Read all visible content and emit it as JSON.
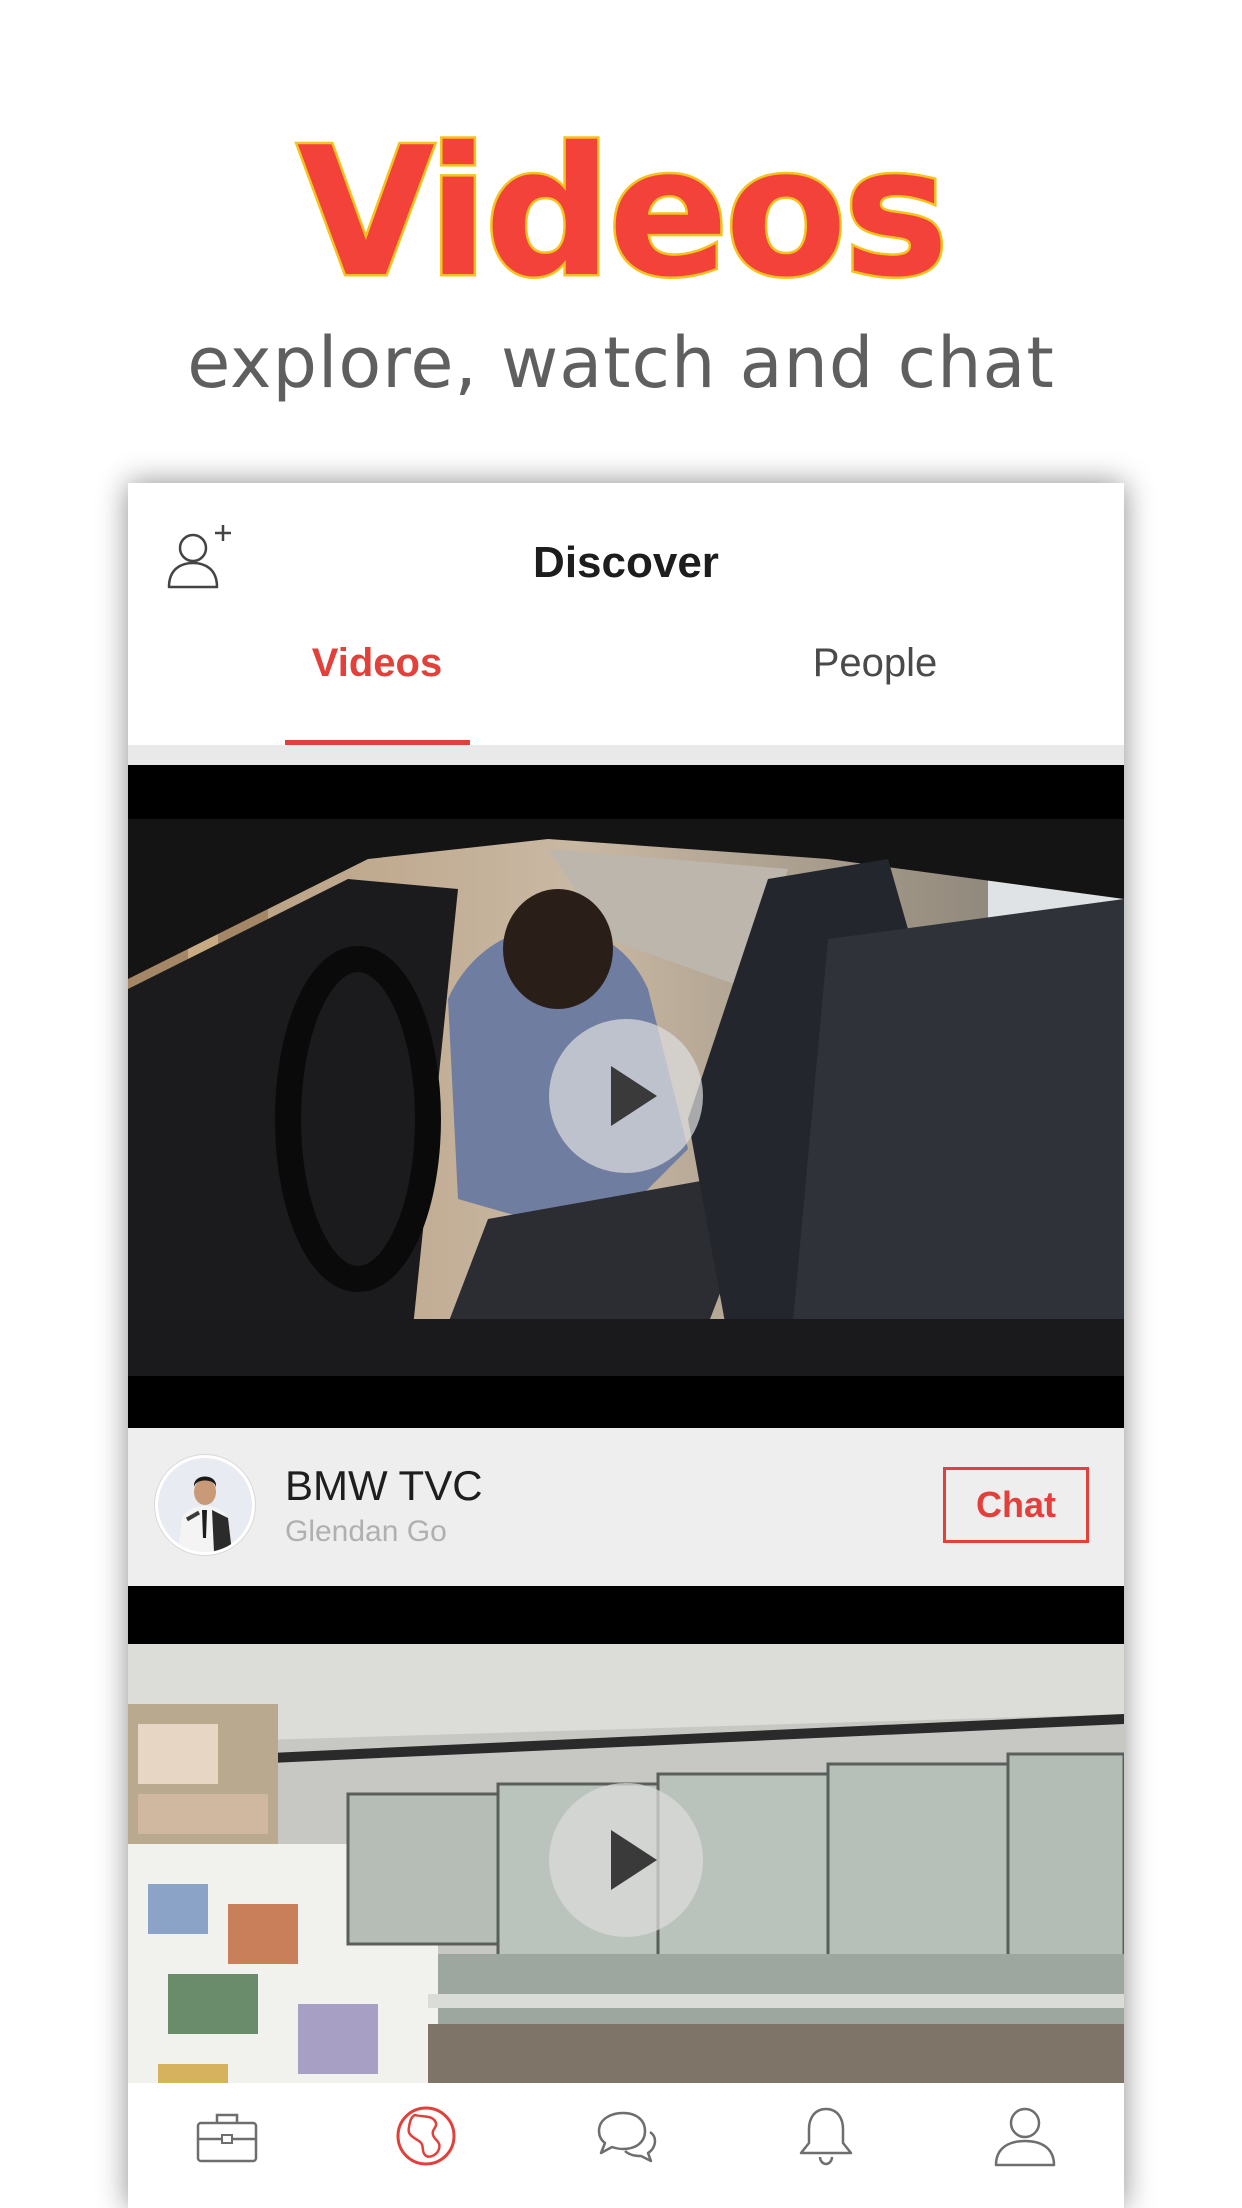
{
  "promo": {
    "title": "Videos",
    "subtitle": "explore, watch and chat"
  },
  "nav": {
    "title": "Discover",
    "add_friend_icon": "add-person-icon"
  },
  "tabs": [
    {
      "label": "Videos",
      "selected": true
    },
    {
      "label": "People",
      "selected": false
    }
  ],
  "feed": [
    {
      "title": "BMW TVC",
      "author": "Glendan Go",
      "action": "Chat"
    },
    {
      "title": "",
      "author": "",
      "action": ""
    }
  ],
  "tab_bar": [
    {
      "icon": "briefcase-icon",
      "selected": false
    },
    {
      "icon": "globe-icon",
      "selected": true
    },
    {
      "icon": "chat-bubbles-icon",
      "selected": false
    },
    {
      "icon": "bell-icon",
      "selected": false
    },
    {
      "icon": "profile-icon",
      "selected": false
    }
  ],
  "colors": {
    "accent": "#e2403a",
    "promo_title": "#f2423a",
    "promo_title_outline": "#f6c21c",
    "promo_subtitle": "#5f5f5f",
    "icon_gray": "#6e6e6e"
  }
}
